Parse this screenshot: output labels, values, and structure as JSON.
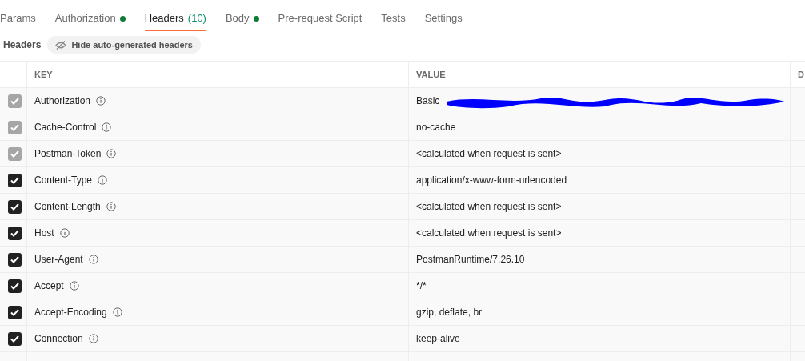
{
  "tabs": [
    {
      "label": "Params",
      "selected": false
    },
    {
      "label": "Authorization",
      "selected": false,
      "color": "#0f7b36"
    },
    {
      "label": "Headers",
      "count": "(10)",
      "selected": true
    },
    {
      "label": "Body",
      "selected": false,
      "color": "#0f7b36"
    },
    {
      "label": "Pre-request Script",
      "selected": false
    },
    {
      "label": "Tests",
      "selected": false
    },
    {
      "label": "Settings",
      "selected": false
    }
  ],
  "section_title": "Headers",
  "toggle_button": "Hide auto-generated headers",
  "table": {
    "columns": [
      "KEY",
      "VALUE",
      "D"
    ],
    "rows": [
      {
        "checked": true,
        "disabled": true,
        "key": "Authorization",
        "value": "Basic",
        "redacted": true
      },
      {
        "checked": true,
        "disabled": true,
        "key": "Cache-Control",
        "value": "no-cache"
      },
      {
        "checked": true,
        "disabled": true,
        "key": "Postman-Token",
        "value": "<calculated when request is sent>"
      },
      {
        "checked": true,
        "disabled": false,
        "key": "Content-Type",
        "value": "application/x-www-form-urlencoded"
      },
      {
        "checked": true,
        "disabled": false,
        "key": "Content-Length",
        "value": "<calculated when request is sent>"
      },
      {
        "checked": true,
        "disabled": false,
        "key": "Host",
        "value": "<calculated when request is sent>"
      },
      {
        "checked": true,
        "disabled": false,
        "key": "User-Agent",
        "value": "PostmanRuntime/7.26.10"
      },
      {
        "checked": true,
        "disabled": false,
        "key": "Accept",
        "value": "*/*"
      },
      {
        "checked": true,
        "disabled": false,
        "key": "Accept-Encoding",
        "value": "gzip, deflate, br"
      },
      {
        "checked": true,
        "disabled": false,
        "key": "Connection",
        "value": "keep-alive"
      }
    ]
  }
}
